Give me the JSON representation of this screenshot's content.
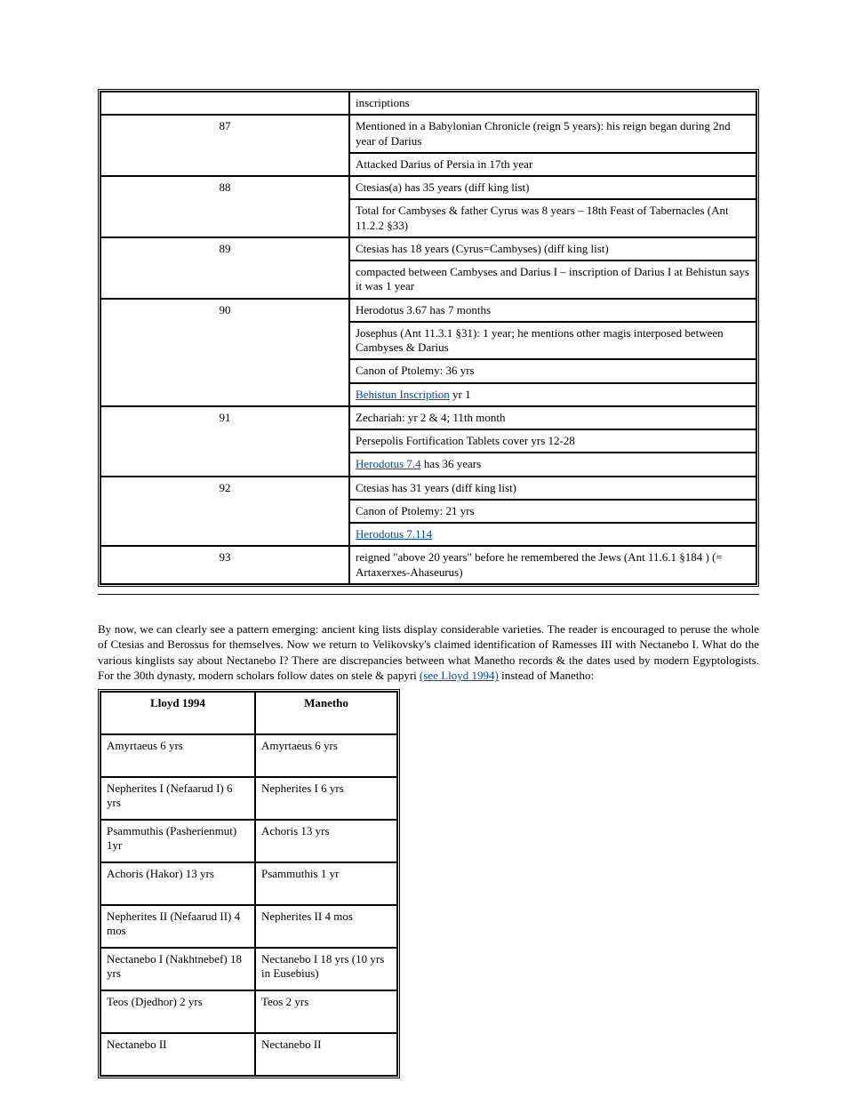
{
  "refs": [
    {
      "num": "",
      "text": "inscriptions"
    },
    {
      "num": "87",
      "text": "Mentioned in a Babylonian Chronicle (reign 5 years): his reign began during 2nd year of Darius"
    },
    {
      "num": "",
      "text": "Attacked Darius of Persia in 17th year"
    },
    {
      "num": "88",
      "text": "Ctesias(a) has 35 years (diff king list)"
    },
    {
      "num": "",
      "text": "Total for Cambyses & father Cyrus was 8 years – 18th Feast of Tabernacles (Ant 11.2.2 §33)"
    },
    {
      "num": "89",
      "text": "Ctesias has 18 years (Cyrus=Cambyses) (diff king list)"
    },
    {
      "num": "",
      "text": "compacted between Cambyses and Darius I – inscription of Darius I at Behistun says it was 1 year"
    },
    {
      "num": "90",
      "text": "Herodotus 3.67 has 7 months"
    },
    {
      "num": "",
      "text": "Josephus (Ant 11.3.1 §31): 1 year; he mentions other magis interposed between Cambyses & Darius"
    },
    {
      "num": "",
      "text": "Canon of Ptolemy: 36 yrs"
    },
    {
      "num": "",
      "text": "Behistun Inscription yr 1"
    },
    {
      "num": "91",
      "text": "Zechariah: yr 2 & 4; 11th month"
    },
    {
      "num": "",
      "text": "Persepolis Fortification Tablets cover yrs 12-28"
    },
    {
      "num": "",
      "text": "Herodotus 7.4 has 36 years"
    },
    {
      "num": "92",
      "text": "Ctesias has 31 years (diff king list)"
    },
    {
      "num": "",
      "text": "Canon of Ptolemy: 21 yrs"
    },
    {
      "num": "",
      "text": "Herodotus 7.114"
    },
    {
      "num": "93",
      "text": "reigned \"above 20 years\" before he remembered the Jews (Ant 11.6.1 §184 ) (= Artaxerxes-Ahaseurus)"
    }
  ],
  "prose": {
    "p1": "By now, we can clearly see a pattern emerging: ancient king lists display considerable varieties. The reader is encouraged to peruse the whole of Ctesias and Berossus for themselves. Now we return to Velikovsky's claimed identification of Ramesses III with Nectanebo I. What do the various kinglists say about Nectanebo I? There are discrepancies between what Manetho records & the dates used by modern Egyptologists. For the 30th dynasty, modern scholars follow dates on stele & papyri ",
    "p1_link": "(see Lloyd 1994)",
    "p1_after": " instead of Manetho:",
    "books_header_left": "Lloyd 1994",
    "books_header_right": "Manetho",
    "books_rows": [
      {
        "left": "Amyrtaeus    6 yrs",
        "right": "Amyrtaeus    6 yrs"
      },
      {
        "left": "Nepherites I (Nefaarud I)   6 yrs",
        "right": "Nepherites I    6 yrs"
      },
      {
        "left": "Psammuthis (Pasherienmut)   1yr",
        "right": "Achoris     13 yrs"
      },
      {
        "left": "Achoris (Hakor)  13 yrs",
        "right": "Psammuthis   1 yr"
      },
      {
        "left": "Nepherites II (Nefaarud II) 4 mos",
        "right": "Nepherites II   4 mos"
      },
      {
        "left": "Nectanebo I (Nakhtnebef) 18 yrs",
        "right": "Nectanebo I     18 yrs (10 yrs in Eusebius)"
      },
      {
        "left": "Teos (Djedhor)  2 yrs",
        "right": "Teos    2 yrs"
      },
      {
        "left": "Nectanebo II",
        "right": "Nectanebo II"
      }
    ]
  }
}
